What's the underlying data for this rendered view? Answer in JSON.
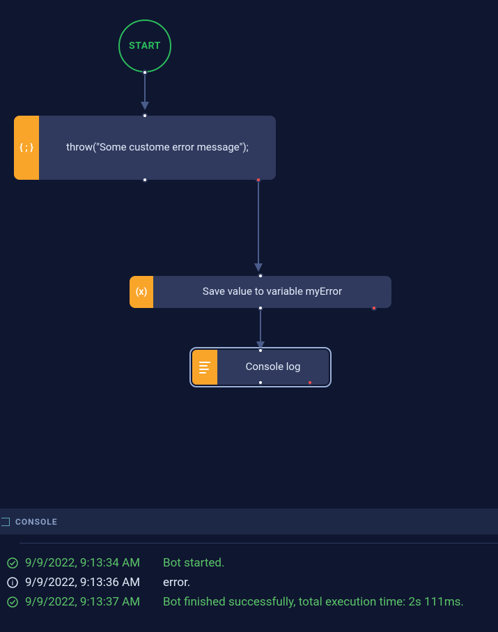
{
  "flow": {
    "start": {
      "label": "START"
    },
    "throw_node": {
      "icon": "{ ; }",
      "label": "throw(\"Some custome error message\");"
    },
    "save_node": {
      "icon": "(x)",
      "label": "Save value to variable myError"
    },
    "log_node": {
      "label": "Console log"
    }
  },
  "console": {
    "title": "CONSOLE",
    "rows": [
      {
        "type": "success",
        "ts": "9/9/2022, 9:13:34 AM",
        "msg": "Bot started."
      },
      {
        "type": "error",
        "ts": "9/9/2022, 9:13:36 AM",
        "msg": "error."
      },
      {
        "type": "success",
        "ts": "9/9/2022, 9:13:37 AM",
        "msg": "Bot finished successfully, total execution time: 2s 111ms."
      }
    ]
  }
}
